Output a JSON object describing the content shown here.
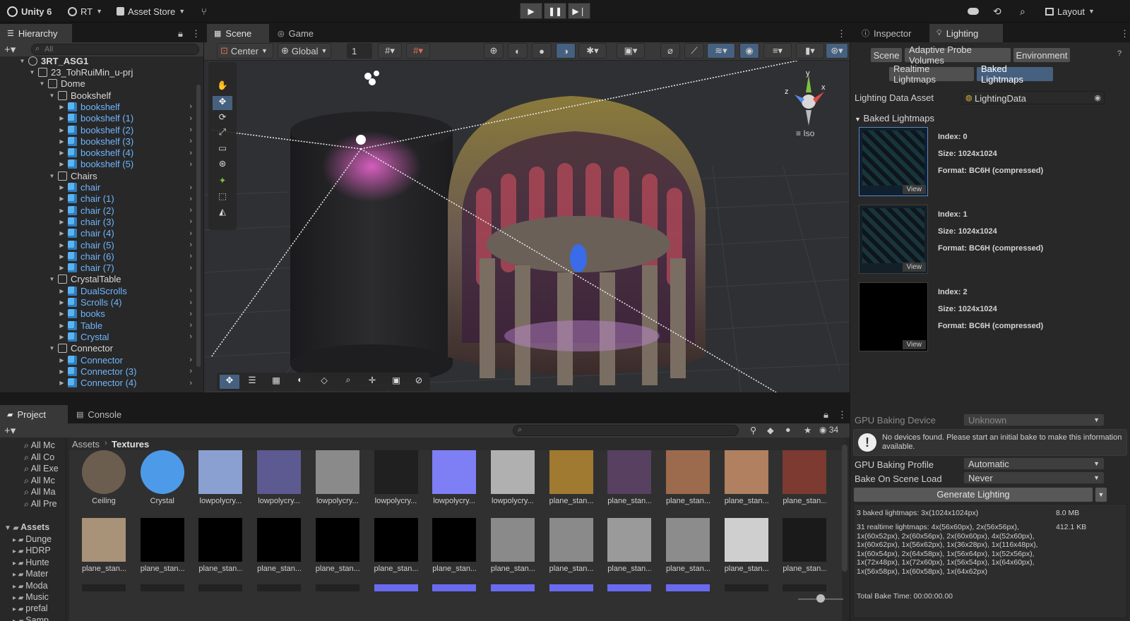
{
  "app": {
    "name": "Unity 6",
    "account": "RT",
    "asset_store": "Asset Store",
    "layout": "Layout"
  },
  "colors": {
    "accent": "#46607f",
    "hier_blue": "#6fb6ff",
    "panel": "#282828",
    "bg": "#191919"
  },
  "hierarchy": {
    "tab": "Hierarchy",
    "search_placeholder": "All",
    "rows": [
      {
        "label": "3RT_ASG1",
        "depth": 0,
        "icon": "unity-scene-icon",
        "style": "white"
      },
      {
        "label": "23_TohRuiMin_u-prj",
        "depth": 1,
        "icon": "grey",
        "style": "white"
      },
      {
        "label": "Dome",
        "depth": 2,
        "icon": "grey",
        "style": "white"
      },
      {
        "label": "Bookshelf",
        "depth": 3,
        "icon": "grey",
        "style": "white"
      },
      {
        "label": "bookshelf",
        "depth": 4,
        "icon": "blue",
        "style": "blue"
      },
      {
        "label": "bookshelf (1)",
        "depth": 4,
        "icon": "blue",
        "style": "blue"
      },
      {
        "label": "bookshelf (2)",
        "depth": 4,
        "icon": "blue",
        "style": "blue"
      },
      {
        "label": "bookshelf (3)",
        "depth": 4,
        "icon": "blue",
        "style": "blue"
      },
      {
        "label": "bookshelf (4)",
        "depth": 4,
        "icon": "blue",
        "style": "blue"
      },
      {
        "label": "bookshelf (5)",
        "depth": 4,
        "icon": "blue",
        "style": "blue"
      },
      {
        "label": "Chairs",
        "depth": 3,
        "icon": "grey",
        "style": "white"
      },
      {
        "label": "chair",
        "depth": 4,
        "icon": "blue",
        "style": "blue"
      },
      {
        "label": "chair (1)",
        "depth": 4,
        "icon": "blue",
        "style": "blue"
      },
      {
        "label": "chair (2)",
        "depth": 4,
        "icon": "blue",
        "style": "blue"
      },
      {
        "label": "chair (3)",
        "depth": 4,
        "icon": "blue",
        "style": "blue"
      },
      {
        "label": "chair (4)",
        "depth": 4,
        "icon": "blue",
        "style": "blue"
      },
      {
        "label": "chair (5)",
        "depth": 4,
        "icon": "blue",
        "style": "blue"
      },
      {
        "label": "chair (6)",
        "depth": 4,
        "icon": "blue",
        "style": "blue"
      },
      {
        "label": "chair (7)",
        "depth": 4,
        "icon": "blue",
        "style": "blue"
      },
      {
        "label": "CrystalTable",
        "depth": 3,
        "icon": "grey",
        "style": "white"
      },
      {
        "label": "DualScrolls",
        "depth": 4,
        "icon": "blue",
        "style": "blue"
      },
      {
        "label": "Scrolls (4)",
        "depth": 4,
        "icon": "blue",
        "style": "blue"
      },
      {
        "label": "books",
        "depth": 4,
        "icon": "blue",
        "style": "blue"
      },
      {
        "label": "Table",
        "depth": 4,
        "icon": "blue",
        "style": "blue"
      },
      {
        "label": "Crystal",
        "depth": 4,
        "icon": "blue",
        "style": "blue"
      },
      {
        "label": "Connector",
        "depth": 3,
        "icon": "grey",
        "style": "white"
      },
      {
        "label": "Connector",
        "depth": 4,
        "icon": "blue",
        "style": "blue"
      },
      {
        "label": "Connector (3)",
        "depth": 4,
        "icon": "blue",
        "style": "blue"
      },
      {
        "label": "Connector (4)",
        "depth": 4,
        "icon": "blue",
        "style": "blue"
      }
    ]
  },
  "scene": {
    "tabs": [
      "Scene",
      "Game"
    ],
    "pivot": "Center",
    "space": "Global",
    "grid_value": "1",
    "iso_label": "Iso",
    "gizmo_axes": [
      "y",
      "z",
      "x"
    ]
  },
  "inspector": {
    "tabs": [
      "Inspector",
      "Lighting"
    ],
    "sub_tabs": [
      "Scene",
      "Adaptive Probe Volumes",
      "Environment"
    ],
    "sub_tabs2": [
      "Realtime Lightmaps",
      "Baked Lightmaps"
    ],
    "data_asset_label": "Lighting Data Asset",
    "data_asset_value": "LightingData",
    "section": "Baked Lightmaps",
    "lightmaps": [
      {
        "index": "Index: 0",
        "size": "Size: 1024x1024",
        "format": "Format: BC6H (compressed)",
        "view": "View"
      },
      {
        "index": "Index: 1",
        "size": "Size: 1024x1024",
        "format": "Format: BC6H (compressed)",
        "view": "View"
      },
      {
        "index": "Index: 2",
        "size": "Size: 1024x1024",
        "format": "Format: BC6H (compressed)",
        "view": "View"
      }
    ],
    "gpu_device_label": "GPU Baking Device",
    "gpu_device_value": "Unknown",
    "warning": "No devices found. Please start an initial bake to make this information available.",
    "gpu_profile_label": "GPU Baking Profile",
    "gpu_profile_value": "Automatic",
    "bake_on_load_label": "Bake On Scene Load",
    "bake_on_load_value": "Never",
    "generate_button": "Generate Lighting",
    "stats_baked": "3 baked lightmaps: 3x(1024x1024px)",
    "stats_baked_size": "8.0 MB",
    "stats_realtime": "31 realtime lightmaps: 4x(56x60px), 2x(56x56px), 1x(60x52px), 2x(60x56px), 2x(60x60px), 4x(52x60px), 1x(60x62px), 1x(56x62px), 1x(36x28px), 1x(116x48px), 1x(60x54px), 2x(64x58px), 1x(56x64px), 1x(52x56px), 1x(72x48px), 1x(72x60px), 1x(56x54px), 1x(64x60px), 1x(56x58px), 1x(60x58px), 1x(64x62px)",
    "stats_realtime_size": "412.1 KB",
    "bake_time": "Total Bake Time: 00:00:00.00"
  },
  "project": {
    "tabs": [
      "Project",
      "Console"
    ],
    "breadcrumb": [
      "Assets",
      "Textures"
    ],
    "count": "34",
    "left_items": [
      "All Mc",
      "All Co",
      "All Exe",
      "All Mc",
      "All Ma",
      "All Pre"
    ],
    "assets_root": "Assets",
    "folders": [
      "Dunge",
      "HDRP",
      "Hunte",
      "Mater",
      "Moda",
      "Music",
      "prefal",
      "Samp"
    ],
    "row1": [
      {
        "name": "Ceiling",
        "thumb": "#6b5e4e"
      },
      {
        "name": "Crystal",
        "thumb": "#4d9be8"
      },
      {
        "name": "lowpolycry...",
        "thumb": "#8aa0d0"
      },
      {
        "name": "lowpolycry...",
        "thumb": "#5c5a90"
      },
      {
        "name": "lowpolycry...",
        "thumb": "#8a8a8a"
      },
      {
        "name": "lowpolycry...",
        "thumb": "#202020"
      },
      {
        "name": "lowpolycry...",
        "thumb": "#7e7ef5"
      },
      {
        "name": "lowpolycry...",
        "thumb": "#b0b0b0"
      },
      {
        "name": "plane_stan...",
        "thumb": "#a07a30"
      },
      {
        "name": "plane_stan...",
        "thumb": "#574060"
      },
      {
        "name": "plane_stan...",
        "thumb": "#9c6a4c"
      },
      {
        "name": "plane_stan...",
        "thumb": "#b08060"
      },
      {
        "name": "plane_stan...",
        "thumb": "#7c3a30"
      }
    ],
    "row2": [
      {
        "name": "plane_stan...",
        "thumb": "#a89278"
      },
      {
        "name": "plane_stan...",
        "thumb": "#000000"
      },
      {
        "name": "plane_stan...",
        "thumb": "#000000"
      },
      {
        "name": "plane_stan...",
        "thumb": "#000000"
      },
      {
        "name": "plane_stan...",
        "thumb": "#000000"
      },
      {
        "name": "plane_stan...",
        "thumb": "#000000"
      },
      {
        "name": "plane_stan...",
        "thumb": "#000000"
      },
      {
        "name": "plane_stan...",
        "thumb": "#8a8a8a"
      },
      {
        "name": "plane_stan...",
        "thumb": "#8a8a8a"
      },
      {
        "name": "plane_stan...",
        "thumb": "#9a9a9a"
      },
      {
        "name": "plane_stan...",
        "thumb": "#8c8c8c"
      },
      {
        "name": "plane_stan...",
        "thumb": "#cfcfcf"
      },
      {
        "name": "plane_stan...",
        "thumb": "#1a1a1a"
      }
    ]
  }
}
